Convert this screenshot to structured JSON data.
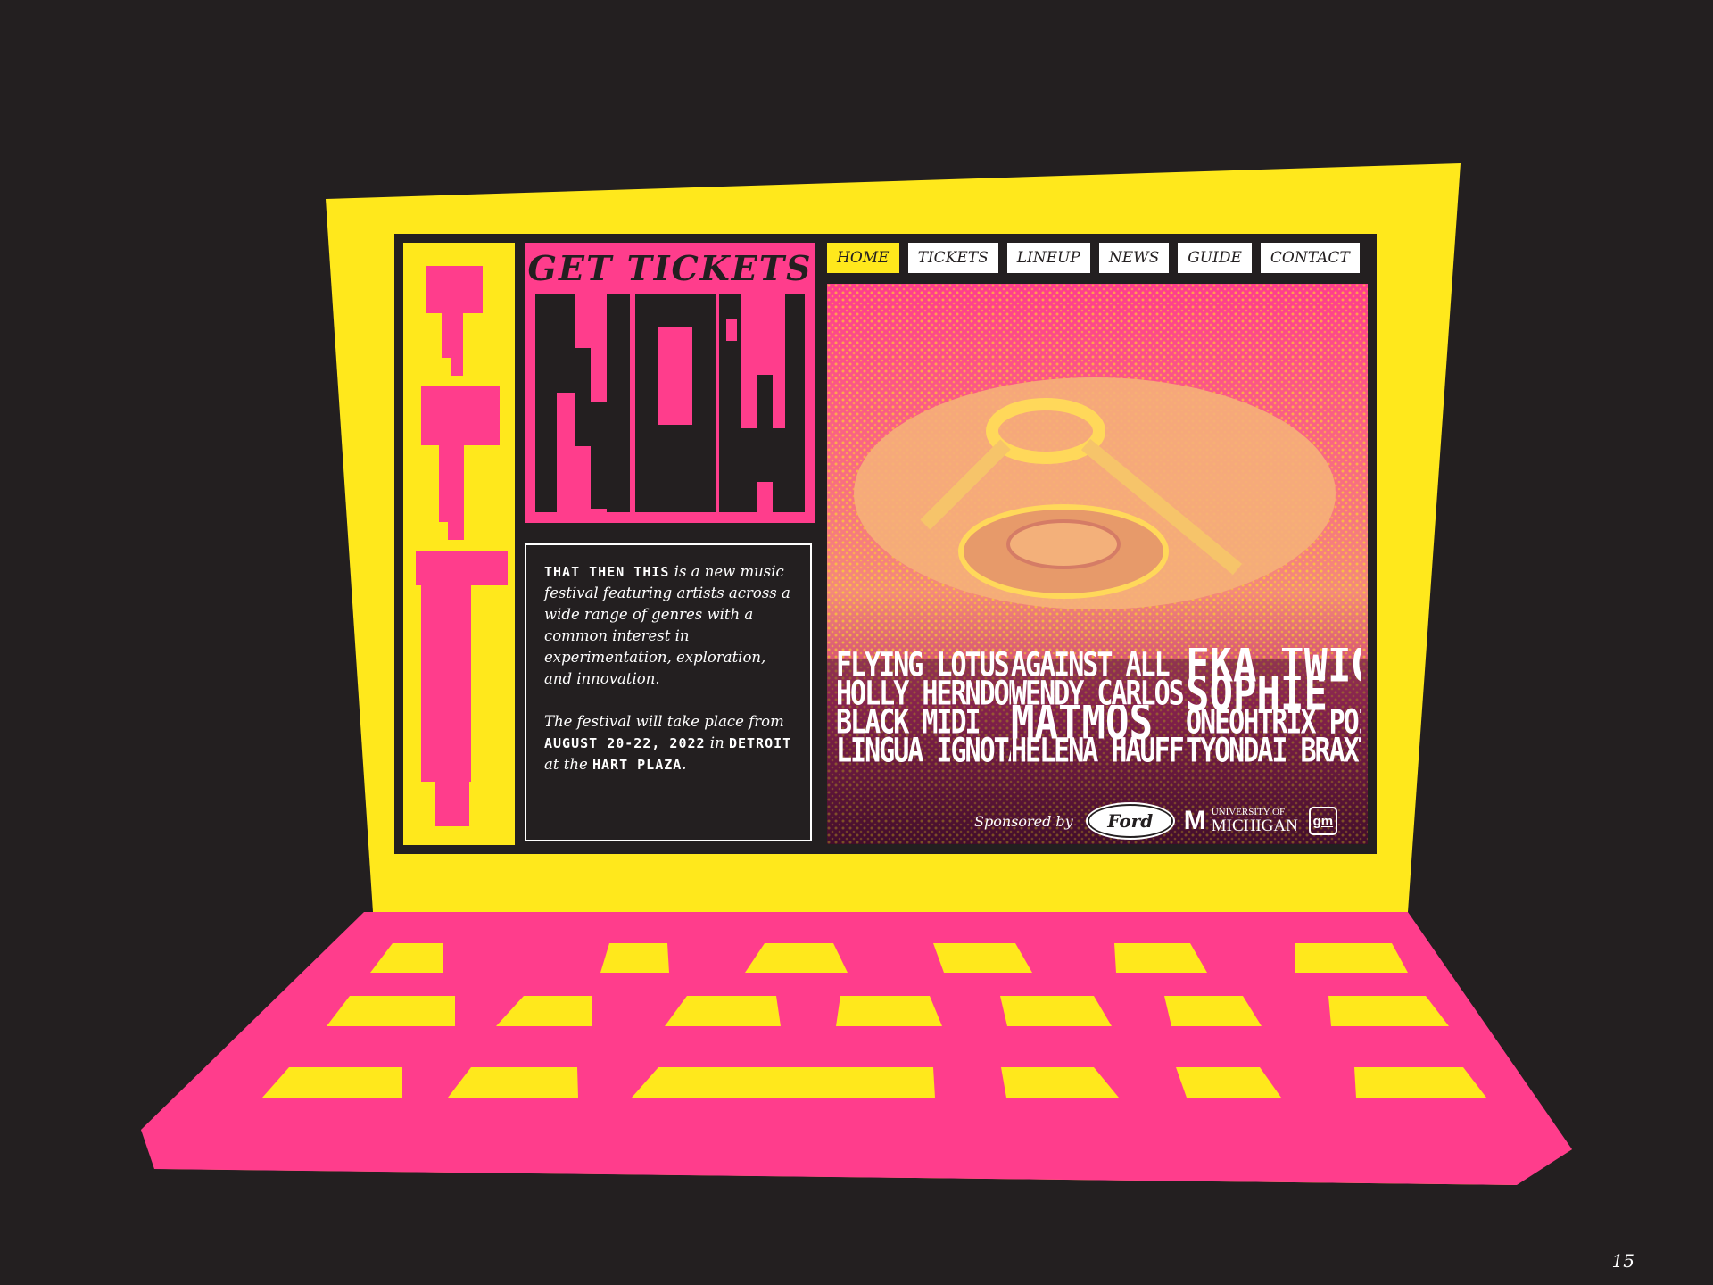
{
  "colors": {
    "background": "#231f20",
    "yellow": "#ffe81c",
    "pink": "#ff3d8c",
    "white": "#ffffff"
  },
  "logo": {
    "letters": "TTT"
  },
  "tickets": {
    "title": "GET TICKETS",
    "big_word": "NOW"
  },
  "about": {
    "festival_name": "THAT THEN THIS",
    "p1_rest": " is a new music festival featuring artists across a wide range of genres with a common interest in experimentation, exploration, and innovation.",
    "p2_intro": "The festival will take place from ",
    "dates": "AUGUST 20-22, 2022",
    "p2_mid": " in ",
    "city": "DETROIT",
    "p2_mid2": " at the ",
    "venue": "HART PLAZA",
    "p2_end": "."
  },
  "nav": {
    "items": [
      {
        "label": "HOME",
        "active": true
      },
      {
        "label": "TICKETS",
        "active": false
      },
      {
        "label": "LINEUP",
        "active": false
      },
      {
        "label": "NEWS",
        "active": false
      },
      {
        "label": "GUIDE",
        "active": false
      },
      {
        "label": "CONTACT",
        "active": false
      }
    ]
  },
  "lineup": {
    "acts": [
      "FLYING LOTUS",
      "AGAINST ALL LOGIC",
      "FKA TWIGS",
      "HOLLY HERNDON",
      "WENDY CARLOS",
      "SOPHIE",
      "BLACK MIDI",
      "MATMOS",
      "ONEOHTRIX POINT NEVER",
      "LINGUA IGNOTA",
      "HELENA HAUFF",
      "TYONDAI BRAXTON"
    ]
  },
  "sponsors": {
    "label": "Sponsored by",
    "ford": "Ford",
    "um_line1": "UNIVERSITY OF",
    "um_line2": "MICHIGAN",
    "um_mark": "M",
    "gm": "gm"
  },
  "page_number": "15"
}
